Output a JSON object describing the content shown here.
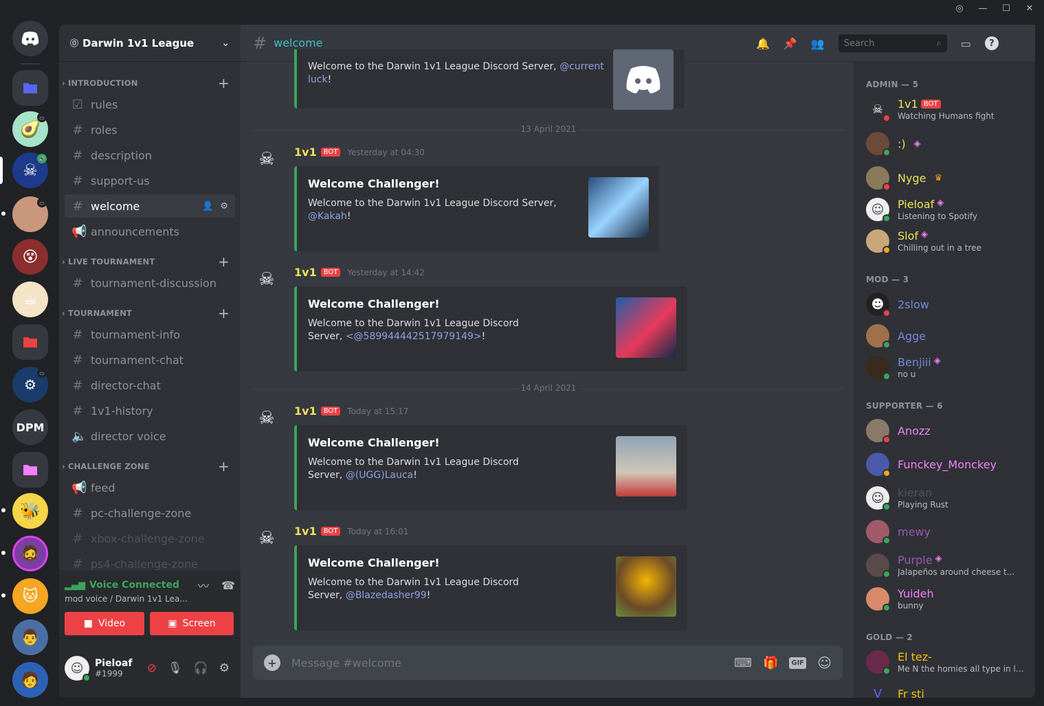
{
  "server": {
    "name": "Darwin 1v1 League"
  },
  "rail": {
    "dpm_label": "DPM"
  },
  "categories": [
    {
      "name": "INTRODUCTION",
      "channels": [
        "rules",
        "roles",
        "description",
        "support-us",
        "welcome",
        "announcements"
      ]
    },
    {
      "name": "LIVE TOURNAMENT",
      "channels": [
        "tournament-discussion"
      ]
    },
    {
      "name": "TOURNAMENT",
      "channels": [
        "tournament-info",
        "tournament-chat",
        "director-chat",
        "1v1-history",
        "director voice"
      ]
    },
    {
      "name": "CHALLENGE ZONE",
      "channels": [
        "feed",
        "pc-challenge-zone",
        "xbox-challenge-zone",
        "ps4-challenge-zone"
      ]
    }
  ],
  "voice": {
    "status": "Voice Connected",
    "location": "mod voice / Darwin 1v1 Lea...",
    "video_label": "Video",
    "screen_label": "Screen"
  },
  "user": {
    "name": "Pieloaf",
    "tag": "#1999"
  },
  "channel": {
    "name": "welcome",
    "placeholder": "Message #welcome"
  },
  "search": {
    "placeholder": "Search"
  },
  "messages": [
    {
      "desc": "Welcome to the Darwin 1v1 League Discord Server,",
      "mention": "@current luck",
      "suffix": "!"
    },
    {
      "author": "1v1",
      "bot": "BOT",
      "time": "Yesterday at 04:30",
      "title": "Welcome Challenger!",
      "desc": "Welcome to the Darwin 1v1 League Discord Server,",
      "mention": "@Kakah",
      "suffix": "!"
    },
    {
      "author": "1v1",
      "bot": "BOT",
      "time": "Yesterday at 14:42",
      "title": "Welcome Challenger!",
      "desc": "Welcome to the Darwin 1v1 League Discord Server,",
      "mention": "<@589944442517979149>",
      "suffix": "!"
    },
    {
      "author": "1v1",
      "bot": "BOT",
      "time": "Today at 15:17",
      "title": "Welcome Challenger!",
      "desc": "Welcome to the Darwin 1v1 League Discord Server,",
      "mention": "@(UGG)Lauca",
      "suffix": "!"
    },
    {
      "author": "1v1",
      "bot": "BOT",
      "time": "Today at 16:01",
      "title": "Welcome Challenger!",
      "desc": "Welcome to the Darwin 1v1 League Discord Server,",
      "mention": "@Blazedasher99",
      "suffix": "!"
    }
  ],
  "dividers": [
    "13 April 2021",
    "14 April 2021"
  ],
  "member_groups": [
    {
      "title": "ADMIN — 5",
      "members": [
        {
          "name": "1v1",
          "bot": "BOT",
          "status": "Watching Humans fight",
          "color": "#f1e35a"
        },
        {
          "name": ":)",
          "status": "",
          "color": "#f1e35a"
        },
        {
          "name": "Nyge",
          "status": "",
          "color": "#f1e35a"
        },
        {
          "name": "Pieloaf",
          "status": "Listening to Spotify",
          "color": "#f1e35a"
        },
        {
          "name": "Slof",
          "status": "Chilling out in a tree",
          "color": "#f1e35a"
        }
      ]
    },
    {
      "title": "MOD — 3",
      "members": [
        {
          "name": "2slow",
          "status": "",
          "color": "#7289da"
        },
        {
          "name": "Agge",
          "status": "",
          "color": "#7289da"
        },
        {
          "name": "Benjiii",
          "status": "no u",
          "color": "#7289da"
        }
      ]
    },
    {
      "title": "SUPPORTER — 6",
      "members": [
        {
          "name": "Anozz",
          "status": "",
          "color": "#f47fff"
        },
        {
          "name": "Funckey_Monckey",
          "status": "",
          "color": "#f47fff"
        },
        {
          "name": "kieran",
          "status": "Playing Rust",
          "color": "#4f545c"
        },
        {
          "name": "mewy",
          "status": "",
          "color": "#9b59b6"
        },
        {
          "name": "Purple",
          "status": "Jalapeños around cheese t...",
          "color": "#9b59b6"
        },
        {
          "name": "Yuideh",
          "status": "bunny",
          "color": "#f47fff"
        }
      ]
    },
    {
      "title": "GOLD — 2",
      "members": [
        {
          "name": "El tez-",
          "status": "Me N the homies all type in lo...",
          "color": "#f1c40f"
        },
        {
          "name": "Fr sti",
          "status": "",
          "color": "#f1c40f"
        }
      ]
    }
  ]
}
